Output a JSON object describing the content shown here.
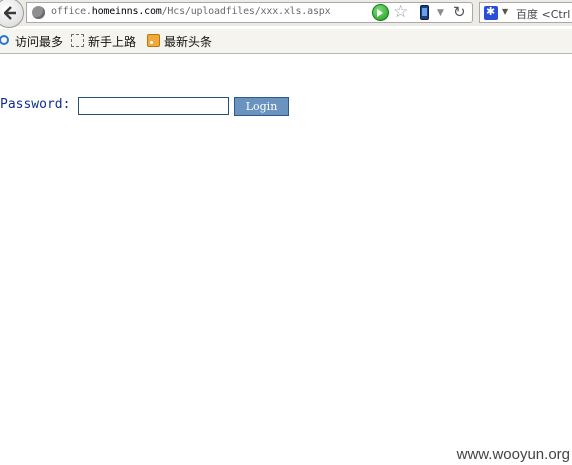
{
  "browser": {
    "url_prefix": "office.",
    "url_host": "homeinns.com",
    "url_path": "/Hcs/uploadfiles/xxx.xls.aspx",
    "search_placeholder": "百度 <Ctrl",
    "icons": [
      "back-arrow-icon",
      "site-identity-icon",
      "go-icon",
      "bookmark-star-icon",
      "mobile-icon",
      "history-dropdown-icon",
      "reload-icon",
      "search-engine-icon"
    ]
  },
  "bookmarks": [
    {
      "label": "访问最多",
      "icon": "most-visited-icon"
    },
    {
      "label": "新手上路",
      "icon": "folder-icon"
    },
    {
      "label": "最新头条",
      "icon": "rss-feed-icon"
    }
  ],
  "form": {
    "password_label": "Password:",
    "password_value": "",
    "login_label": "Login"
  },
  "watermark": "www.wooyun.org",
  "colors": {
    "label_text": "#0f2f8f",
    "login_button": "#6b93bf",
    "chrome_bg": "#ecebe6"
  }
}
